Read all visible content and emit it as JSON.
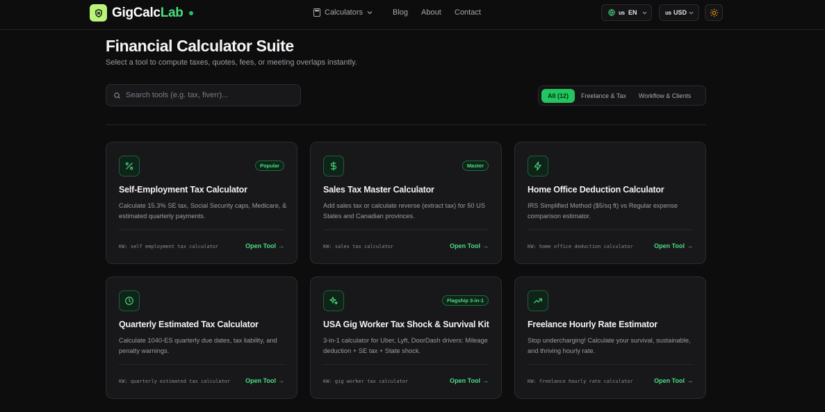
{
  "brand": {
    "name_part1": "GigCalc",
    "name_part2": "Lab"
  },
  "nav": {
    "calculators": "Calculators",
    "blog": "Blog",
    "about": "About",
    "contact": "Contact"
  },
  "header": {
    "lang_code": "us",
    "lang": "EN",
    "currency_code": "us",
    "currency": "USD"
  },
  "page": {
    "title": "Financial Calculator Suite",
    "subtitle": "Select a tool to compute taxes, quotes, fees, or meeting overlaps instantly."
  },
  "search": {
    "placeholder": "Search tools (e.g. tax, fiverr)..."
  },
  "filters": [
    "All (12)",
    "Freelance & Tax",
    "Workflow & Clients"
  ],
  "open_label": "Open Tool",
  "cards": [
    {
      "icon": "percent-icon",
      "badge": "Popular",
      "title": "Self-Employment Tax Calculator",
      "desc": "Calculate 15.3% SE tax, Social Security caps, Medicare, & estimated quarterly payments.",
      "kw": "KW: self employment tax calculator"
    },
    {
      "icon": "dollar-icon",
      "badge": "Master",
      "title": "Sales Tax Master Calculator",
      "desc": "Add sales tax or calculate reverse (extract tax) for 50 US States and Canadian provinces.",
      "kw": "KW: sales tax calculator"
    },
    {
      "icon": "lightning-icon",
      "badge": "",
      "title": "Home Office Deduction Calculator",
      "desc": "IRS Simplified Method ($5/sq ft) vs Regular expense comparison estimator.",
      "kw": "KW: home office deduction calculator"
    },
    {
      "icon": "clock-icon",
      "badge": "",
      "title": "Quarterly Estimated Tax Calculator",
      "desc": "Calculate 1040-ES quarterly due dates, tax liability, and penalty warnings.",
      "kw": "KW: quarterly estimated tax calculator"
    },
    {
      "icon": "sparkle-icon",
      "badge": "Flagship 3-in-1",
      "title": "USA Gig Worker Tax Shock & Survival Kit",
      "desc": "3-in-1 calculator for Uber, Lyft, DoorDash drivers: Mileage deduction + SE tax + State shock.",
      "kw": "KW: gig worker tax calculator"
    },
    {
      "icon": "trending-up-icon",
      "badge": "",
      "title": "Freelance Hourly Rate Estimator",
      "desc": "Stop undercharging! Calculate your survival, sustainable, and thriving hourly rate.",
      "kw": "KW: freelance hourly rate calculator"
    }
  ],
  "colors": {
    "accent": "#22c55e",
    "background": "#0d0d0e",
    "card": "#18181b"
  }
}
